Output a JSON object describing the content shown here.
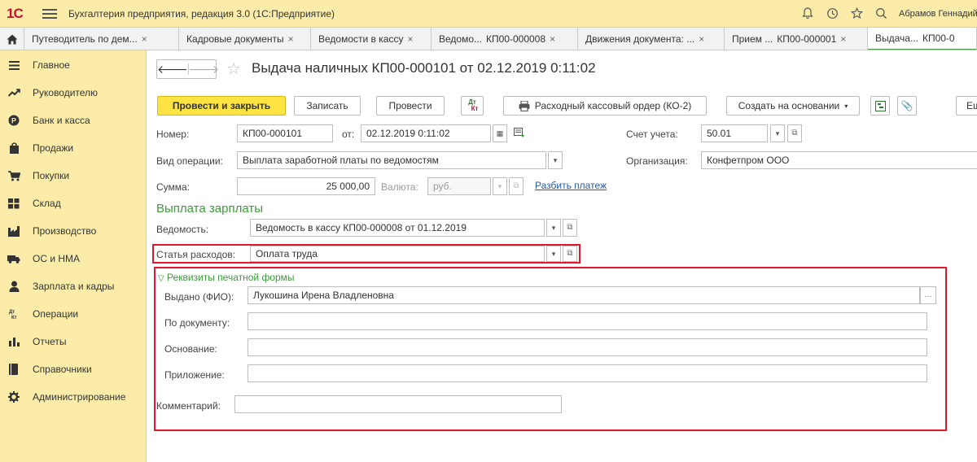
{
  "app": {
    "logo": "1С",
    "title": "Бухгалтерия предприятия, редакция 3.0  (1С:Предприятие)",
    "user": "Абрамов Геннадий"
  },
  "tabs": [
    {
      "label": "Путеводитель по дем...",
      "close": "×"
    },
    {
      "label": "Кадровые документы",
      "close": "×"
    },
    {
      "label": "Ведомости в кассу",
      "close": "×"
    },
    {
      "label": "Ведомо...",
      "label2": "КП00-000008",
      "close": "×"
    },
    {
      "label": "Движения документа: ...",
      "close": "×"
    },
    {
      "label": "Прием ...",
      "label2": "КП00-000001",
      "close": "×"
    },
    {
      "label": "Выдача...",
      "label2": "КП00-0"
    }
  ],
  "sidebar": {
    "items": [
      {
        "label": "Главное",
        "icon": "menu-lines-icon"
      },
      {
        "label": "Руководителю",
        "icon": "trend-icon"
      },
      {
        "label": "Банк и касса",
        "icon": "coin-icon"
      },
      {
        "label": "Продажи",
        "icon": "bag-icon"
      },
      {
        "label": "Покупки",
        "icon": "cart-icon"
      },
      {
        "label": "Склад",
        "icon": "warehouse-icon"
      },
      {
        "label": "Производство",
        "icon": "factory-icon"
      },
      {
        "label": "ОС и НМА",
        "icon": "truck-icon"
      },
      {
        "label": "Зарплата и кадры",
        "icon": "person-icon"
      },
      {
        "label": "Операции",
        "icon": "dt-kt-icon"
      },
      {
        "label": "Отчеты",
        "icon": "bar-chart-icon"
      },
      {
        "label": "Справочники",
        "icon": "book-icon"
      },
      {
        "label": "Администрирование",
        "icon": "gear-icon"
      }
    ]
  },
  "doc": {
    "title": "Выдача наличных КП00-000101 от 02.12.2019 0:11:02"
  },
  "toolbar": {
    "post_close": "Провести и закрыть",
    "save": "Записать",
    "post": "Провести",
    "dtkt_top": "Дт",
    "dtkt_bottom": "Кт",
    "print_order": "Расходный кассовый ордер (КО-2)",
    "create_based": "Создать на основании",
    "more": "Ещ"
  },
  "form": {
    "number_label": "Номер:",
    "number_value": "КП00-000101",
    "date_label": "от:",
    "date_value": "02.12.2019  0:11:02",
    "account_label": "Счет учета:",
    "account_value": "50.01",
    "operation_label": "Вид операции:",
    "operation_value": "Выплата заработной платы по ведомостям",
    "org_label": "Организация:",
    "org_value": "Конфетпром ООО",
    "sum_label": "Сумма:",
    "sum_value": "25 000,00",
    "currency_label": "Валюта:",
    "currency_value": "руб.",
    "split_link": "Разбить платеж",
    "section_title": "Выплата зарплаты",
    "statement_label": "Ведомость:",
    "statement_value": "Ведомость в кассу КП00-000008 от 01.12.2019",
    "expense_label": "Статья расходов:",
    "expense_value": "Оплата труда",
    "print_group": "Реквизиты печатной формы",
    "issued_label": "Выдано (ФИО):",
    "issued_value": "Лукошина Ирена Владленовна",
    "by_doc_label": "По документу:",
    "by_doc_value": "",
    "basis_label": "Основание:",
    "basis_value": "",
    "attachment_label": "Приложение:",
    "attachment_value": "",
    "comment_label": "Комментарий:",
    "comment_value": ""
  },
  "colors": {
    "sidebar_bg": "#fbeda9",
    "primary_button": "#fde443",
    "accent_green": "#3b9b3b",
    "highlight_red": "#e3162a",
    "link_blue": "#2558a6"
  }
}
